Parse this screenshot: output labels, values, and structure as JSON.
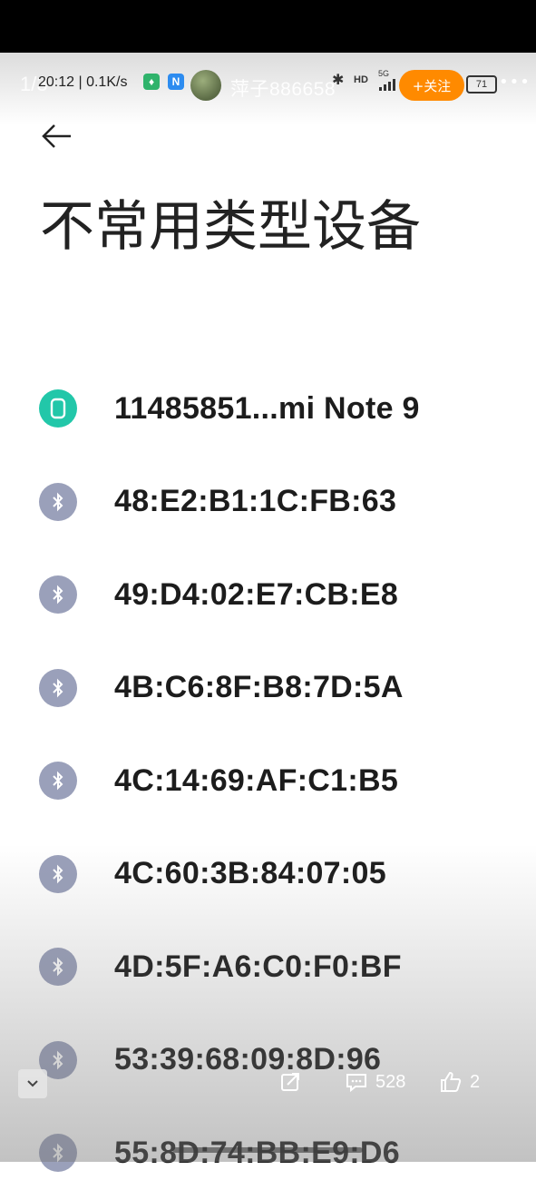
{
  "status_bar": {
    "counter": "1/3",
    "time": "20:12 | 0.1K/s",
    "signal": "5G",
    "hd": "HD",
    "battery": "71"
  },
  "viewer": {
    "username": "萍子886658",
    "follow_label": "+关注",
    "more": "•••",
    "comments_count": "528",
    "likes_count": "2"
  },
  "page": {
    "title": "不常用类型设备"
  },
  "devices": [
    {
      "type": "phone",
      "name": "11485851...mi Note 9"
    },
    {
      "type": "bluetooth",
      "name": "48:E2:B1:1C:FB:63"
    },
    {
      "type": "bluetooth",
      "name": "49:D4:02:E7:CB:E8"
    },
    {
      "type": "bluetooth",
      "name": "4B:C6:8F:B8:7D:5A"
    },
    {
      "type": "bluetooth",
      "name": "4C:14:69:AF:C1:B5"
    },
    {
      "type": "bluetooth",
      "name": "4C:60:3B:84:07:05"
    },
    {
      "type": "bluetooth",
      "name": "4D:5F:A6:C0:F0:BF"
    },
    {
      "type": "bluetooth",
      "name": "53:39:68:09:8D:96"
    },
    {
      "type": "bluetooth",
      "name": "55:8D:74:BB:E9:D6"
    }
  ],
  "colors": {
    "bluetooth_icon_bg": "#9aa0ba",
    "phone_icon_bg": "#22c7a9",
    "follow_button": "#ff8a00"
  }
}
